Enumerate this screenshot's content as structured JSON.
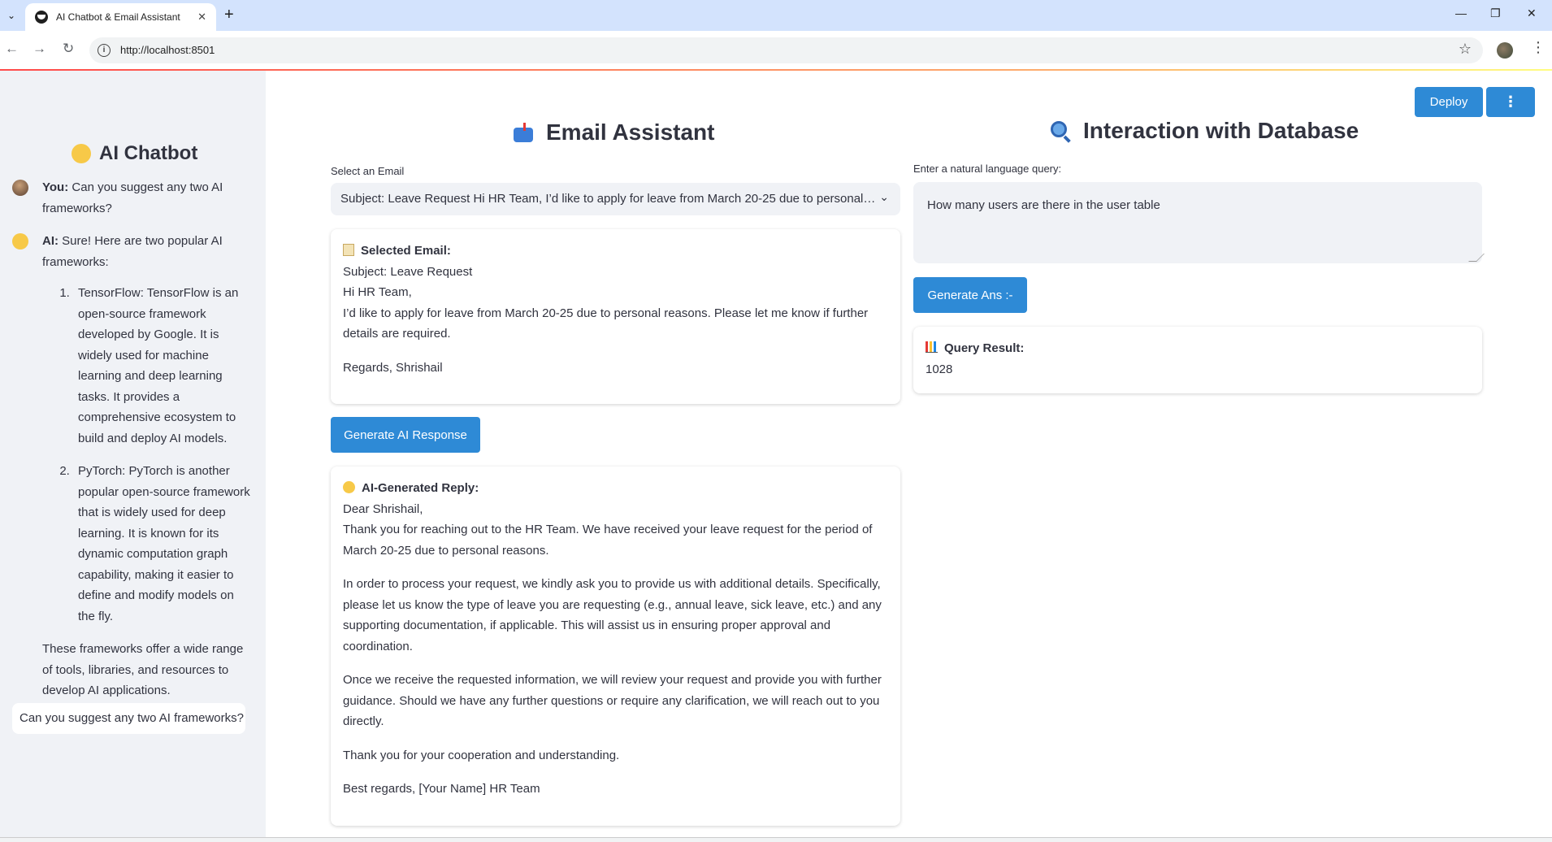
{
  "browser": {
    "tab_title": "AI Chatbot & Email Assistant",
    "url": "http://localhost:8501",
    "new_tab": "+",
    "close_tab": "✕",
    "minimize": "—",
    "restore": "❐",
    "close_window": "✕"
  },
  "app_header": {
    "deploy_label": "Deploy",
    "menu_icon": "⋮"
  },
  "sidebar": {
    "title": "AI Chatbot",
    "messages": [
      {
        "role": "You:",
        "text": "Can you suggest any two AI frameworks?"
      },
      {
        "role": "AI:",
        "text": "Sure! Here are two popular AI frameworks:",
        "items": [
          "TensorFlow: TensorFlow is an open-source framework developed by Google. It is widely used for machine learning and deep learning tasks. It provides a comprehensive ecosystem to build and deploy AI models.",
          "PyTorch: PyTorch is another popular open-source framework that is widely used for deep learning. It is known for its dynamic computation graph capability, making it easier to define and modify models on the fly."
        ],
        "closing": "These frameworks offer a wide range of tools, libraries, and resources to develop AI applications."
      }
    ],
    "input_value": "Can you suggest any two AI frameworks?"
  },
  "email_assistant": {
    "title": "Email Assistant",
    "select_label": "Select an Email",
    "select_value": "Subject: Leave Request Hi HR Team, I’d like to apply for leave from March 20-25 due to personal…",
    "selected_heading": "Selected Email:",
    "selected_lines": [
      "Subject: Leave Request",
      "Hi HR Team,",
      "I’d like to apply for leave from March 20-25 due to personal reasons. Please let me know if further details are required.",
      "Regards, Shrishail"
    ],
    "generate_label": "Generate AI Response",
    "reply_heading": "AI-Generated Reply:",
    "reply_paragraphs": [
      "Dear Shrishail,",
      "Thank you for reaching out to the HR Team. We have received your leave request for the period of March 20-25 due to personal reasons.",
      "In order to process your request, we kindly ask you to provide us with additional details. Specifically, please let us know the type of leave you are requesting (e.g., annual leave, sick leave, etc.) and any supporting documentation, if applicable. This will assist us in ensuring proper approval and coordination.",
      "Once we receive the requested information, we will review your request and provide you with further guidance. Should we have any further questions or require any clarification, we will reach out to you directly.",
      "Thank you for your cooperation and understanding.",
      "Best regards, [Your Name] HR Team"
    ]
  },
  "database": {
    "title": "Interaction with Database",
    "query_label": "Enter a natural language query:",
    "query_value": "How many users are there in the user table",
    "generate_label": "Generate Ans :-",
    "result_heading": "Query Result:",
    "result_value": "1028"
  }
}
